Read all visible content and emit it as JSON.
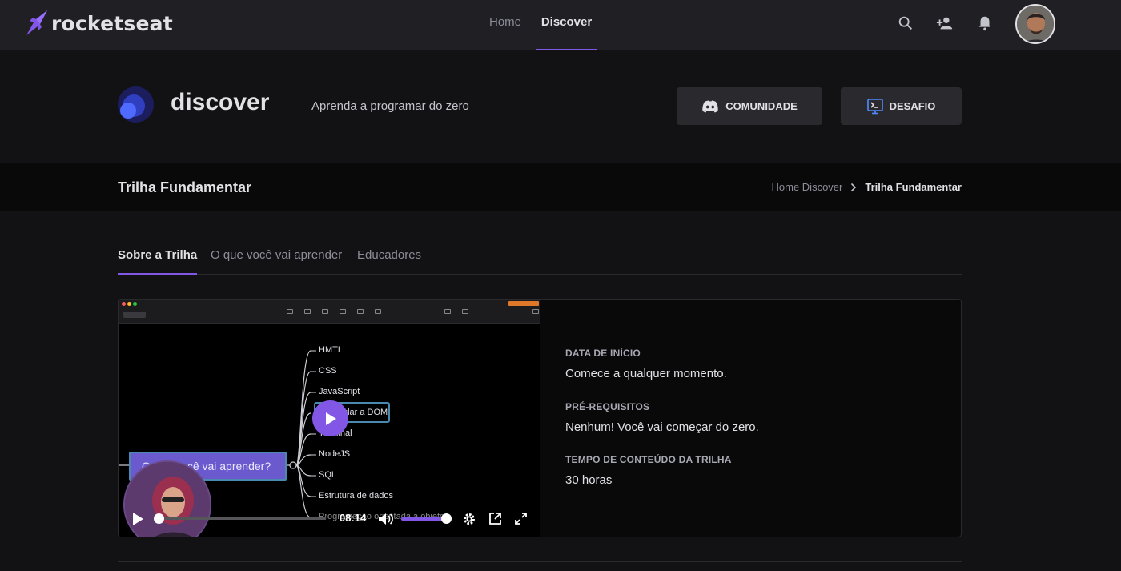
{
  "brand": {
    "name": "rocketseat",
    "accent": "#8257e5"
  },
  "topnav": {
    "links": [
      {
        "label": "Home",
        "active": false
      },
      {
        "label": "Discover",
        "active": true
      }
    ],
    "icons": [
      "search-icon",
      "add-user-icon",
      "bell-icon"
    ]
  },
  "discover": {
    "title": "discover",
    "subtitle": "Aprenda a programar do zero",
    "community_button": "COMUNIDADE",
    "challenge_button": "DESAFIO"
  },
  "breadcrumb": {
    "page_title": "Trilha Fundamentar",
    "items": [
      "Home Discover",
      "Trilha Fundamentar"
    ]
  },
  "tabs": [
    {
      "label": "Sobre a Trilha",
      "active": true
    },
    {
      "label": "O que você vai aprender",
      "active": false
    },
    {
      "label": "Educadores",
      "active": false
    }
  ],
  "video": {
    "mindmap_root": "O que você vai aprender?",
    "mindmap_items": [
      "HMTL",
      "CSS",
      "JavaScript",
      "Manipular a DOM",
      "Terminal",
      "NodeJS",
      "SQL",
      "Estrutura de dados",
      "Programação orientada a objetos"
    ],
    "current_time": "08:14",
    "progress": 0.01,
    "volume": 1.0
  },
  "info": {
    "start_label": "DATA DE INÍCIO",
    "start_value": "Comece a qualquer momento.",
    "prereq_label": "PRÉ-REQUISITOS",
    "prereq_value": "Nenhum! Você vai começar do zero.",
    "duration_label": "TEMPO DE CONTEÚDO DA TRILHA",
    "duration_value": "30 horas"
  }
}
